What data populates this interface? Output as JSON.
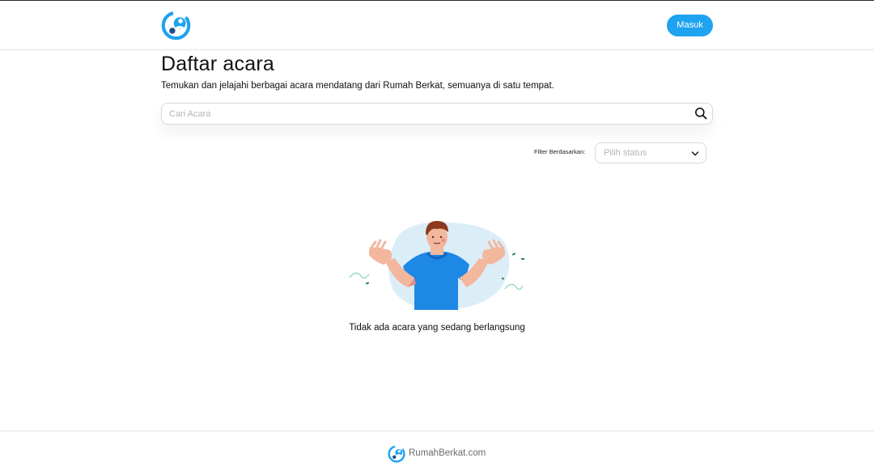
{
  "header": {
    "logo_icon": "rumahberkat-logo-icon",
    "login_label": "Masuk"
  },
  "main": {
    "title": "Daftar acara",
    "subtitle": "Temukan dan jelajahi berbagai acara mendatang dari Rumah Berkat, semuanya di satu tempat.",
    "search": {
      "placeholder": "Cari Acara",
      "value": "",
      "icon": "search-icon"
    },
    "filter": {
      "label": "Filter Berdasarkan:",
      "select_placeholder": "Pilih status",
      "icon": "chevron-down-icon"
    },
    "empty_state": {
      "illustration": "shrugging-man-illustration",
      "message": "Tidak ada acara yang sedang berlangsung"
    }
  },
  "footer": {
    "logo_icon": "rumahberkat-logo-icon",
    "brand_text": "RumahBerkat.com"
  },
  "colors": {
    "accent": "#1ea3f0",
    "text": "#111111",
    "muted": "#b4b4b4",
    "border": "#d8d8d8"
  }
}
